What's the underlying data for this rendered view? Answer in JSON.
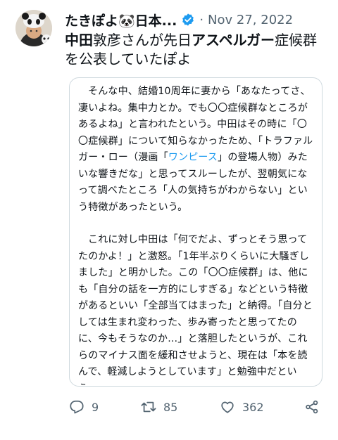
{
  "tweet": {
    "display_name": "たきぽよ🐼日本...",
    "date": "Nov 27, 2022",
    "separator": "·",
    "text_part1": "中田",
    "text_part2": "敦彦さんが先日",
    "text_part3": "アスペルガー",
    "text_part4": "症候群を公表していたぽよ"
  },
  "quote": {
    "para1_a": "そんな中、結婚10周年に妻から「あなたってさ、凄いよね。集中力とか。でも〇〇症候群なところがあるよね」と言われたという。中田はその時に「〇〇症候群」について知らなかったため、「トラファルガー・ロー（漫画「",
    "para1_link": "ワンピース",
    "para1_b": "」の登場人物）みたいな響きだな」と思ってスルーしたが、翌朝気になって調べたところ「人の気持ちがわからない」という特徴があったという。",
    "para2": "これに対し中田は「何でだよ、ずっとそう思ってたのかよ！」と激怒。「1年半ぶりくらいに大騒ぎしました」と明かした。この「〇〇症候群」は、他にも「自分の話を一方的にしすぎる」などという特徴があるといい「全部当てはまった」と納得。「自分としては生まれ変わった、歩み寄ったと思ってたのに、今もそうなのか…」と落胆したというが、これらのマイナス面を緩和させようと、現在は「本を読んで、軽減しようとしています」と勉強中だという。"
  },
  "actions": {
    "replies": "9",
    "retweets": "85",
    "likes": "362",
    "icons": [
      "reply-icon",
      "retweet-icon",
      "like-icon",
      "share-icon"
    ]
  },
  "colors": {
    "accent": "#1d9bf0",
    "muted": "#536471",
    "border": "#cfd9de"
  }
}
